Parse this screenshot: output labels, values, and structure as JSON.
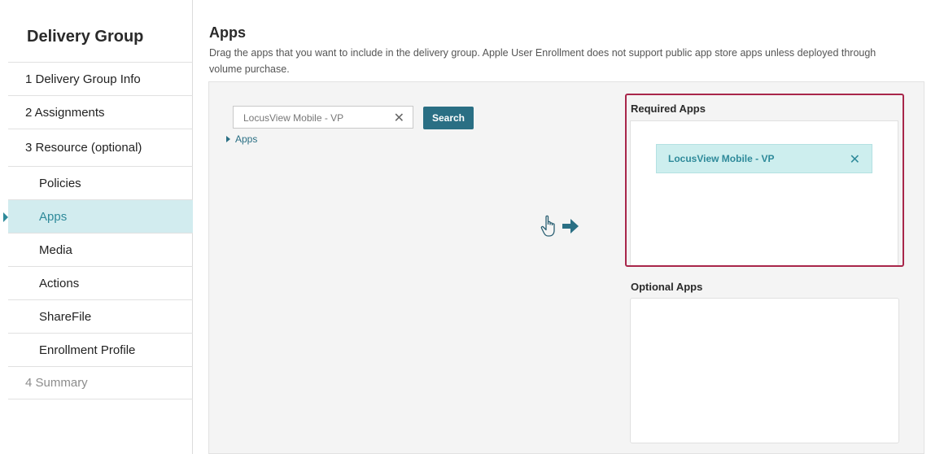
{
  "sidebar": {
    "title": "Delivery Group",
    "items": [
      {
        "label": "1 Delivery Group Info"
      },
      {
        "label": "2 Assignments"
      },
      {
        "label": "3 Resource (optional)"
      },
      {
        "label": "Policies"
      },
      {
        "label": "Apps"
      },
      {
        "label": "Media"
      },
      {
        "label": "Actions"
      },
      {
        "label": "ShareFile"
      },
      {
        "label": "Enrollment Profile"
      },
      {
        "label": "4 Summary"
      }
    ]
  },
  "header": {
    "title": "Apps",
    "description": "Drag the apps that you want to include in the delivery group. Apple User Enrollment does not support public app store apps unless deployed through volume purchase."
  },
  "search": {
    "value": "LocusView Mobile - VP",
    "button_label": "Search"
  },
  "tree": {
    "label": "Apps"
  },
  "required": {
    "label": "Required Apps",
    "apps": [
      "LocusView Mobile - VP"
    ]
  },
  "optional": {
    "label": "Optional Apps"
  },
  "colors": {
    "accent": "#2a6f84",
    "active_bg": "#d2ecef",
    "highlight_border": "#a8264a"
  }
}
